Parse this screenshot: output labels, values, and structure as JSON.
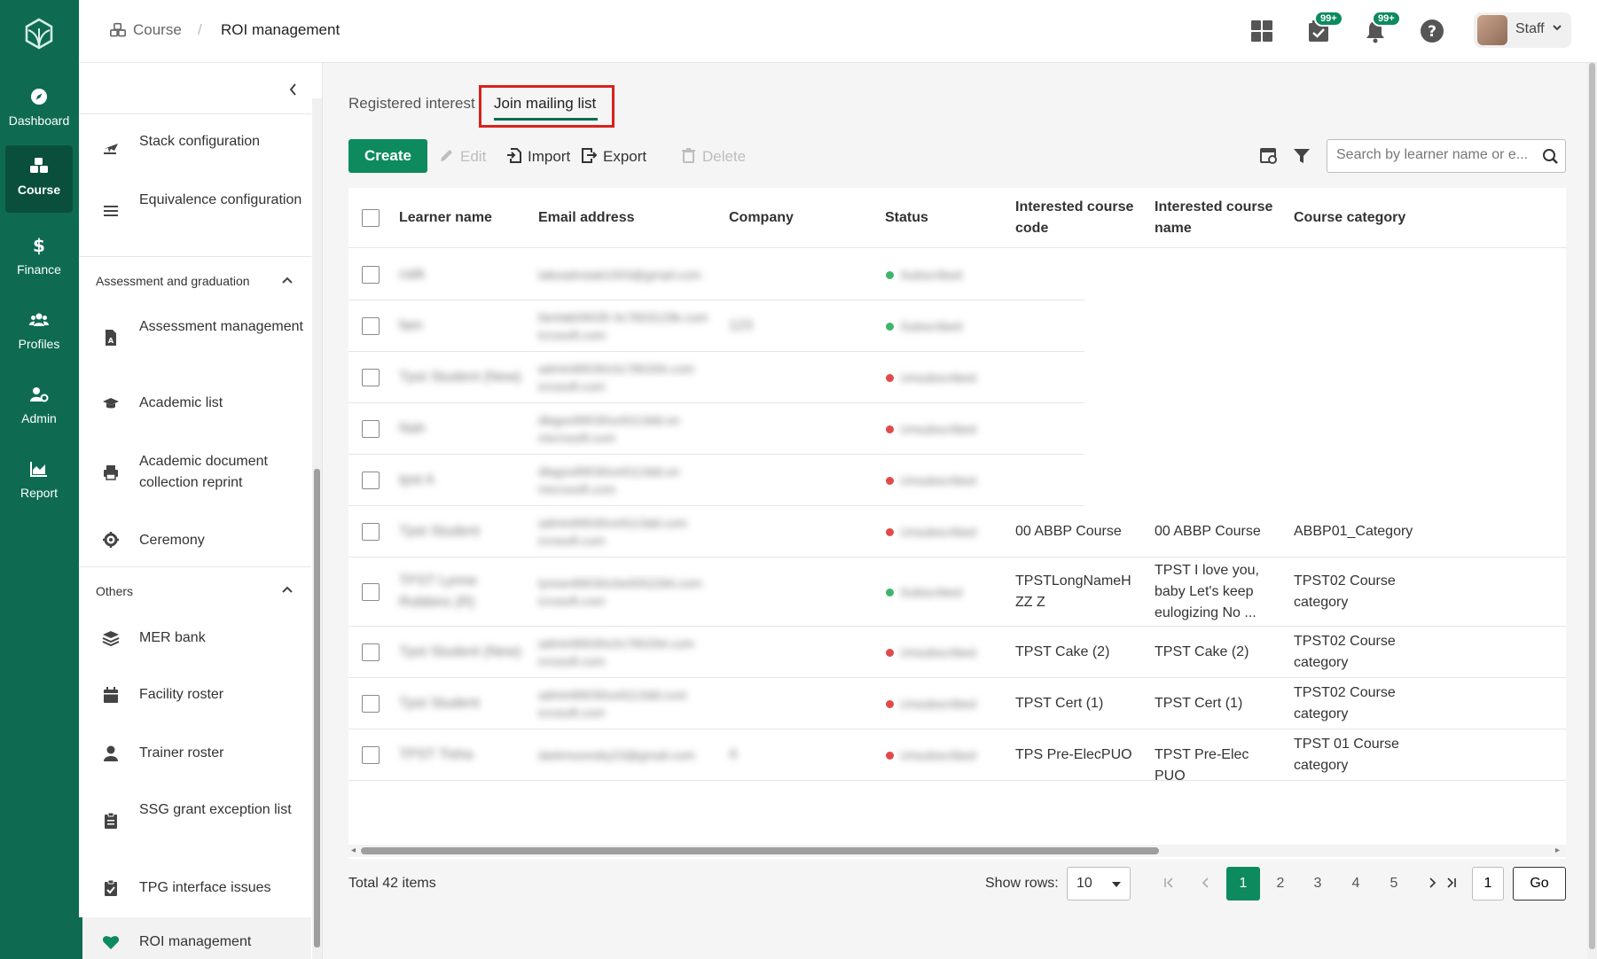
{
  "rail": {
    "items": [
      {
        "label": "Dashboard",
        "icon": "compass-icon"
      },
      {
        "label": "Course",
        "icon": "cubes-icon"
      },
      {
        "label": "Finance",
        "icon": "dollar-icon"
      },
      {
        "label": "Profiles",
        "icon": "users-icon"
      },
      {
        "label": "Admin",
        "icon": "user-gear-icon"
      },
      {
        "label": "Report",
        "icon": "area-chart-icon"
      }
    ],
    "active": "Course"
  },
  "breadcrumb": {
    "item1": "Course",
    "separator": "/",
    "item2": "ROI management"
  },
  "topbar": {
    "badge1": "99+",
    "badge2": "99+",
    "user_name": "Staff"
  },
  "sidebar": {
    "items_top": [
      {
        "label": "Stack configuration",
        "icon": "plane-icon"
      },
      {
        "label": "Equivalence configuration",
        "icon": "list-icon"
      }
    ],
    "section1": "Assessment and graduation",
    "items_s1": [
      {
        "label": "Assessment management",
        "icon": "file-icon"
      },
      {
        "label": "Academic list",
        "icon": "graduation-cap-icon"
      },
      {
        "label": "Academic document collection reprint",
        "icon": "printer-icon"
      },
      {
        "label": "Ceremony",
        "icon": "gear-badge-icon"
      }
    ],
    "section2": "Others",
    "items_s2": [
      {
        "label": "MER bank",
        "icon": "layers-icon"
      },
      {
        "label": "Facility roster",
        "icon": "calendar-icon"
      },
      {
        "label": "Trainer roster",
        "icon": "user-icon"
      },
      {
        "label": "SSG grant exception list",
        "icon": "clipboard-icon"
      },
      {
        "label": "TPG interface issues",
        "icon": "clipboard-check-icon"
      },
      {
        "label": "ROI management",
        "icon": "heart-icon"
      }
    ]
  },
  "tabs": [
    "Registered interest",
    "Join mailing list"
  ],
  "toolbar": {
    "create": "Create",
    "edit": "Edit",
    "import": "Import",
    "export": "Export",
    "delete": "Delete",
    "search_placeholder": "Search by learner name or e..."
  },
  "table": {
    "headers": {
      "learner_name": "Learner name",
      "email": "Email address",
      "company": "Company",
      "status": "Status",
      "course_code": "Interested course code",
      "course_name": "Interested course name",
      "course_category": "Course category"
    },
    "rows": [
      {
        "name": "catk",
        "email": "takeadvstak1003@gmail.com",
        "company": "",
        "status": "Subscribed",
        "status_color": "#3fb56b",
        "code": "",
        "cname": "",
        "cat": ""
      },
      {
        "name": "fam",
        "email": "famlab09035 0c7803129k.com tcrosoft.com",
        "company": "123",
        "status": "Subscribed",
        "status_color": "#3fb56b",
        "code": "",
        "cname": "",
        "cat": ""
      },
      {
        "name": "Tpst Student (New)",
        "email": "admin89030c0c780294.com icrosoft.com",
        "company": "",
        "status": "Unsubscribed",
        "status_color": "#e24a4a",
        "code": "",
        "cname": "",
        "cat": ""
      },
      {
        "name": "Nah",
        "email": "dlagsx89030ce9113dd.on microsoft.com",
        "company": "",
        "status": "Unsubscribed",
        "status_color": "#e24a4a",
        "code": "",
        "cname": "",
        "cat": ""
      },
      {
        "name": "tpst A",
        "email": "dlagsx89030ce9113dd.on microsoft.com",
        "company": "",
        "status": "Unsubscribed",
        "status_color": "#e24a4a",
        "code": "",
        "cname": "",
        "cat": ""
      },
      {
        "name": "Tpst Student",
        "email": "admin89030ce9113dd.com icrosoft.com",
        "company": "",
        "status": "Unsubscribed",
        "status_color": "#e24a4a",
        "code": "00 ABBP Course",
        "cname": "00 ABBP Course",
        "cat": "ABBP01_Category"
      },
      {
        "name": "TPST Lynne Robbins (R)",
        "email": "lynner89030c0e0052284.com icrosoft.com",
        "company": "",
        "status": "Subscribed",
        "status_color": "#3fb56b",
        "code": "TPSTLongNameHZZ Z",
        "cname": "TPST I love you, baby Let's keep eulogizing No ...",
        "cat": "TPST02 Course category"
      },
      {
        "name": "Tpst Student (New)",
        "email": "admin89030c0c780294.com icrosoft.com",
        "company": "",
        "status": "Unsubscribed",
        "status_color": "#e24a4a",
        "code": "TPST Cake (2)",
        "cname": "TPST Cake (2)",
        "cat": "TPST02 Course category"
      },
      {
        "name": "Tpst Student",
        "email": "admin89030ce9113dd.com icrosoft.com",
        "company": "",
        "status": "Unsubscribed",
        "status_color": "#e24a4a",
        "code": "TPST Cert (1)",
        "cname": "TPST Cert (1)",
        "cat": "TPST02 Course category"
      },
      {
        "name": "TPST Tisha",
        "email": "darkmoonsky23@gmail.com",
        "company": "4",
        "status": "Unsubscribed",
        "status_color": "#e24a4a",
        "code": "TPS Pre-ElecPUO",
        "cname": "TPST Pre-Elec PUO",
        "cat": "TPST 01 Course category"
      }
    ]
  },
  "pagination": {
    "total": "Total 42 items",
    "show_rows_label": "Show rows:",
    "rows_value": "10",
    "pages": [
      "1",
      "2",
      "3",
      "4",
      "5"
    ],
    "current": "1",
    "goto_value": "1",
    "go": "Go"
  },
  "colors": {
    "brand": "#0e6b52",
    "accent": "#0e8a5f",
    "highlight": "#d9221c"
  }
}
